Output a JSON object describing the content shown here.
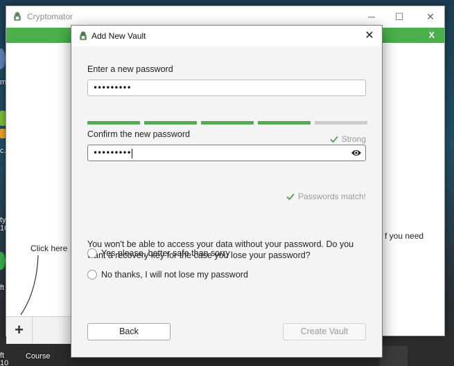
{
  "main_window": {
    "title": "Cryptomator",
    "greenbar_close": "X",
    "side_hint": "f you need",
    "click_hint": "Click here",
    "add_button": "+",
    "window_controls": [
      "minimize-icon",
      "maximize-icon",
      "close-icon"
    ]
  },
  "desktop": {
    "labels": [
      "m",
      "c.",
      "ty",
      "10",
      "ft",
      "ft",
      "Course",
      "10"
    ]
  },
  "dialog": {
    "title": "Add New Vault",
    "new_password_label": "Enter a new password",
    "new_password_value": "•••••••••",
    "strength": {
      "level": 4,
      "max": 5,
      "label": "Strong",
      "filled_color": "#49b04a",
      "empty_color": "#cccccc"
    },
    "confirm_password_label": "Confirm the new password",
    "confirm_password_value": "•••••••••",
    "match_status": "Passwords match!",
    "recovery_question": "You won't be able to access your data without your password. Do you want a recovery key for the case you lose your password?",
    "recovery_options": [
      "Yes please, better safe than sorry",
      "No thanks, I will not lose my password"
    ],
    "back_button": "Back",
    "create_button": "Create Vault"
  },
  "colors": {
    "accent_green": "#49b04a",
    "status_check": "#49b04a"
  }
}
